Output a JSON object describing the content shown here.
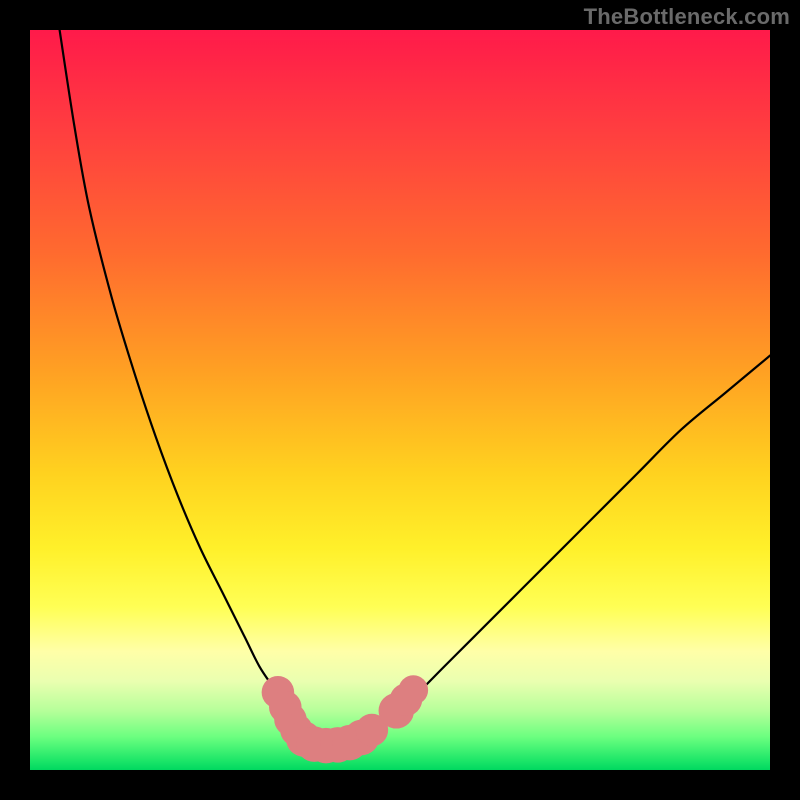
{
  "watermark": "TheBottleneck.com",
  "colors": {
    "frame": "#000000",
    "curve": "#000000",
    "marker_fill": "#dd7f80",
    "marker_stroke": "#b86263",
    "gradient_stops": [
      {
        "offset": 0.0,
        "color": "#ff1a4a"
      },
      {
        "offset": 0.14,
        "color": "#ff3f3f"
      },
      {
        "offset": 0.3,
        "color": "#ff6a2f"
      },
      {
        "offset": 0.46,
        "color": "#ffa023"
      },
      {
        "offset": 0.6,
        "color": "#ffd21f"
      },
      {
        "offset": 0.7,
        "color": "#fff02a"
      },
      {
        "offset": 0.78,
        "color": "#ffff55"
      },
      {
        "offset": 0.84,
        "color": "#ffffa8"
      },
      {
        "offset": 0.88,
        "color": "#eaffb0"
      },
      {
        "offset": 0.92,
        "color": "#b6ff9a"
      },
      {
        "offset": 0.955,
        "color": "#6cff80"
      },
      {
        "offset": 0.985,
        "color": "#22e86a"
      },
      {
        "offset": 1.0,
        "color": "#00d860"
      }
    ]
  },
  "chart_data": {
    "type": "line",
    "title": "",
    "xlabel": "",
    "ylabel": "",
    "xlim": [
      0,
      100
    ],
    "ylim": [
      0,
      100
    ],
    "grid": false,
    "legend": false,
    "series": [
      {
        "name": "bottleneck-curve",
        "x": [
          4,
          6,
          8,
          11,
          14,
          17,
          20,
          23,
          26,
          29,
          31,
          33,
          35,
          36.5,
          38,
          40,
          42,
          45,
          48,
          52,
          56,
          60,
          65,
          70,
          76,
          82,
          88,
          94,
          100
        ],
        "y": [
          100,
          87,
          76,
          64,
          54,
          45,
          37,
          30,
          24,
          18,
          14,
          11,
          8,
          6,
          4.5,
          3.5,
          3.5,
          4.5,
          6.5,
          10,
          14,
          18,
          23,
          28,
          34,
          40,
          46,
          51,
          56
        ]
      }
    ],
    "markers": [
      {
        "x": 33.5,
        "y": 10.5,
        "r": 2.2
      },
      {
        "x": 34.5,
        "y": 8.5,
        "r": 2.2
      },
      {
        "x": 35.2,
        "y": 6.8,
        "r": 2.2
      },
      {
        "x": 36.0,
        "y": 5.4,
        "r": 2.2
      },
      {
        "x": 37.0,
        "y": 4.2,
        "r": 2.4
      },
      {
        "x": 38.4,
        "y": 3.5,
        "r": 2.4
      },
      {
        "x": 40.0,
        "y": 3.3,
        "r": 2.4
      },
      {
        "x": 41.6,
        "y": 3.4,
        "r": 2.4
      },
      {
        "x": 43.2,
        "y": 3.7,
        "r": 2.4
      },
      {
        "x": 44.8,
        "y": 4.4,
        "r": 2.4
      },
      {
        "x": 46.2,
        "y": 5.4,
        "r": 2.2
      },
      {
        "x": 49.5,
        "y": 8.0,
        "r": 2.4
      },
      {
        "x": 50.8,
        "y": 9.5,
        "r": 2.2
      },
      {
        "x": 51.8,
        "y": 10.8,
        "r": 2.0
      }
    ]
  }
}
